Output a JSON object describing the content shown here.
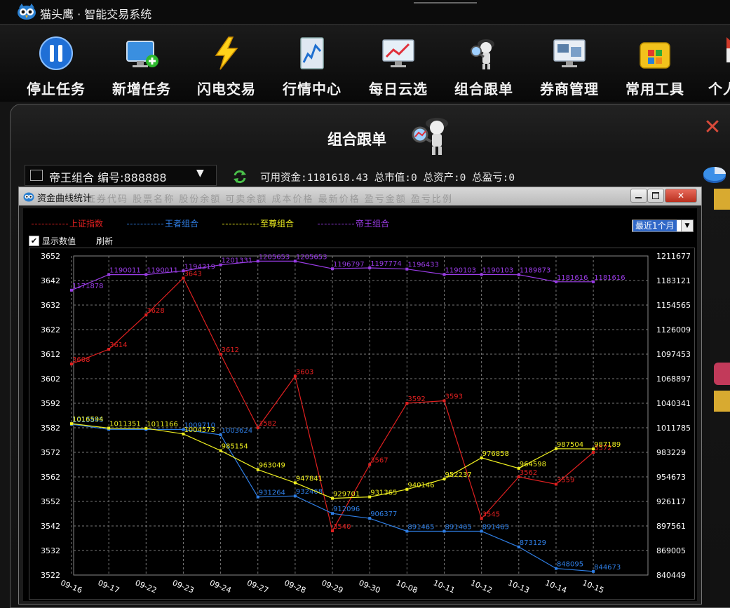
{
  "app": {
    "title": "猫头鹰 · 智能交易系统"
  },
  "toolbar": {
    "items": [
      {
        "label": "停止任务",
        "icon": "pause-icon"
      },
      {
        "label": "新增任务",
        "icon": "monitor-add-icon"
      },
      {
        "label": "闪电交易",
        "icon": "lightning-icon"
      },
      {
        "label": "行情中心",
        "icon": "market-chart-icon"
      },
      {
        "label": "每日云选",
        "icon": "screen-trend-icon"
      },
      {
        "label": "组合跟单",
        "icon": "detective-icon"
      },
      {
        "label": "券商管理",
        "icon": "broker-screen-icon"
      },
      {
        "label": "常用工具",
        "icon": "toolbox-icon"
      },
      {
        "label": "个人",
        "icon": "home-icon"
      }
    ]
  },
  "panel": {
    "title": "组合跟单",
    "combo_text": "帝王组合  编号:888888",
    "funds_info": "可用资金:1181618.43 总市值:0 总资产:0 总盈亏:0"
  },
  "popup": {
    "title": "资金曲线统计",
    "range_selected": "最近1个月",
    "show_values_label": "显示数值",
    "show_values_checked": true,
    "refresh_label": "刷新",
    "ghost_headers": "证券代码  股票名称  股份余额  可卖余额  成本价格  最新价格  盈亏金额  盈亏比例"
  },
  "colors": {
    "index": "#e02020",
    "king": "#2f7fe6",
    "supreme": "#f0f020",
    "emperor": "#9a3ce6",
    "grid": "#777777",
    "axis_text": "#ffffff"
  },
  "chart_data": {
    "type": "line",
    "categories": [
      "09-16",
      "09-17",
      "09-22",
      "09-23",
      "09-24",
      "09-27",
      "09-28",
      "09-29",
      "09-30",
      "10-08",
      "10-11",
      "10-12",
      "10-13",
      "10-14",
      "10-15"
    ],
    "y_left": {
      "ticks": [
        "3652",
        "3642",
        "3632",
        "3622",
        "3612",
        "3602",
        "3592",
        "3582",
        "3572",
        "3562",
        "3552",
        "3542",
        "3532",
        "3522"
      ],
      "range": [
        3522,
        3652
      ]
    },
    "y_right": {
      "ticks": [
        "1211677",
        "1183121",
        "1154565",
        "1126009",
        "1097453",
        "1068897",
        "1040341",
        "1011785",
        "983229",
        "954673",
        "926117",
        "897561",
        "869005",
        "840449"
      ],
      "range": [
        840449,
        1211677
      ]
    },
    "grid": true,
    "legend_position": "top-left",
    "series": [
      {
        "name": "上证指数",
        "axis": "left",
        "color": "#e02020",
        "values": [
          3608,
          3614,
          3628,
          3643,
          3612,
          3582,
          3603,
          3540,
          3567,
          3592,
          3593,
          3545,
          3562,
          3559,
          3572
        ],
        "labels": [
          "3608",
          "3614",
          "3628",
          "3643",
          "3612",
          "3582",
          "3603",
          "3540",
          "3567",
          "3592",
          "3593",
          "3545",
          "3562",
          "3559",
          "3572"
        ]
      },
      {
        "name": "王者组合",
        "axis": "right",
        "color": "#2f7fe6",
        "values": [
          1015845,
          1009900,
          1009800,
          1009710,
          1003624,
          931264,
          932468,
          912096,
          906377,
          891465,
          891465,
          891465,
          873129,
          848095,
          844673
        ],
        "labels": [
          "1015845",
          "",
          "",
          "1009710",
          "1003624",
          "931264",
          "932468",
          "912096",
          "906377",
          "891465",
          "891465",
          "891465",
          "873129",
          "848095",
          "844673"
        ]
      },
      {
        "name": "至尊组合",
        "axis": "right",
        "color": "#f0f020",
        "values": [
          1016594,
          1011351,
          1011166,
          1004573,
          985154,
          963049,
          947841,
          929701,
          931365,
          940146,
          952237,
          976858,
          964598,
          987504,
          987189
        ],
        "labels": [
          "1016594",
          "1011351",
          "1011166",
          "1004573",
          "985154",
          "963049",
          "947841",
          "929701",
          "931365",
          "940146",
          "952237",
          "976858",
          "964598",
          "987504",
          "987189"
        ]
      },
      {
        "name": "帝王组合",
        "axis": "right",
        "color": "#9a3ce6",
        "values": [
          1171878,
          1190011,
          1190011,
          1194319,
          1201331,
          1205653,
          1205653,
          1196797,
          1197774,
          1196433,
          1190103,
          1190103,
          1189873,
          1181616,
          1181616
        ],
        "labels": [
          "1171878",
          "1190011",
          "1190011",
          "1194319",
          "1201331",
          "1205653",
          "1205653",
          "1196797",
          "1197774",
          "1196433",
          "1190103",
          "1190103",
          "1189873",
          "1181616",
          "1181616"
        ]
      }
    ]
  }
}
